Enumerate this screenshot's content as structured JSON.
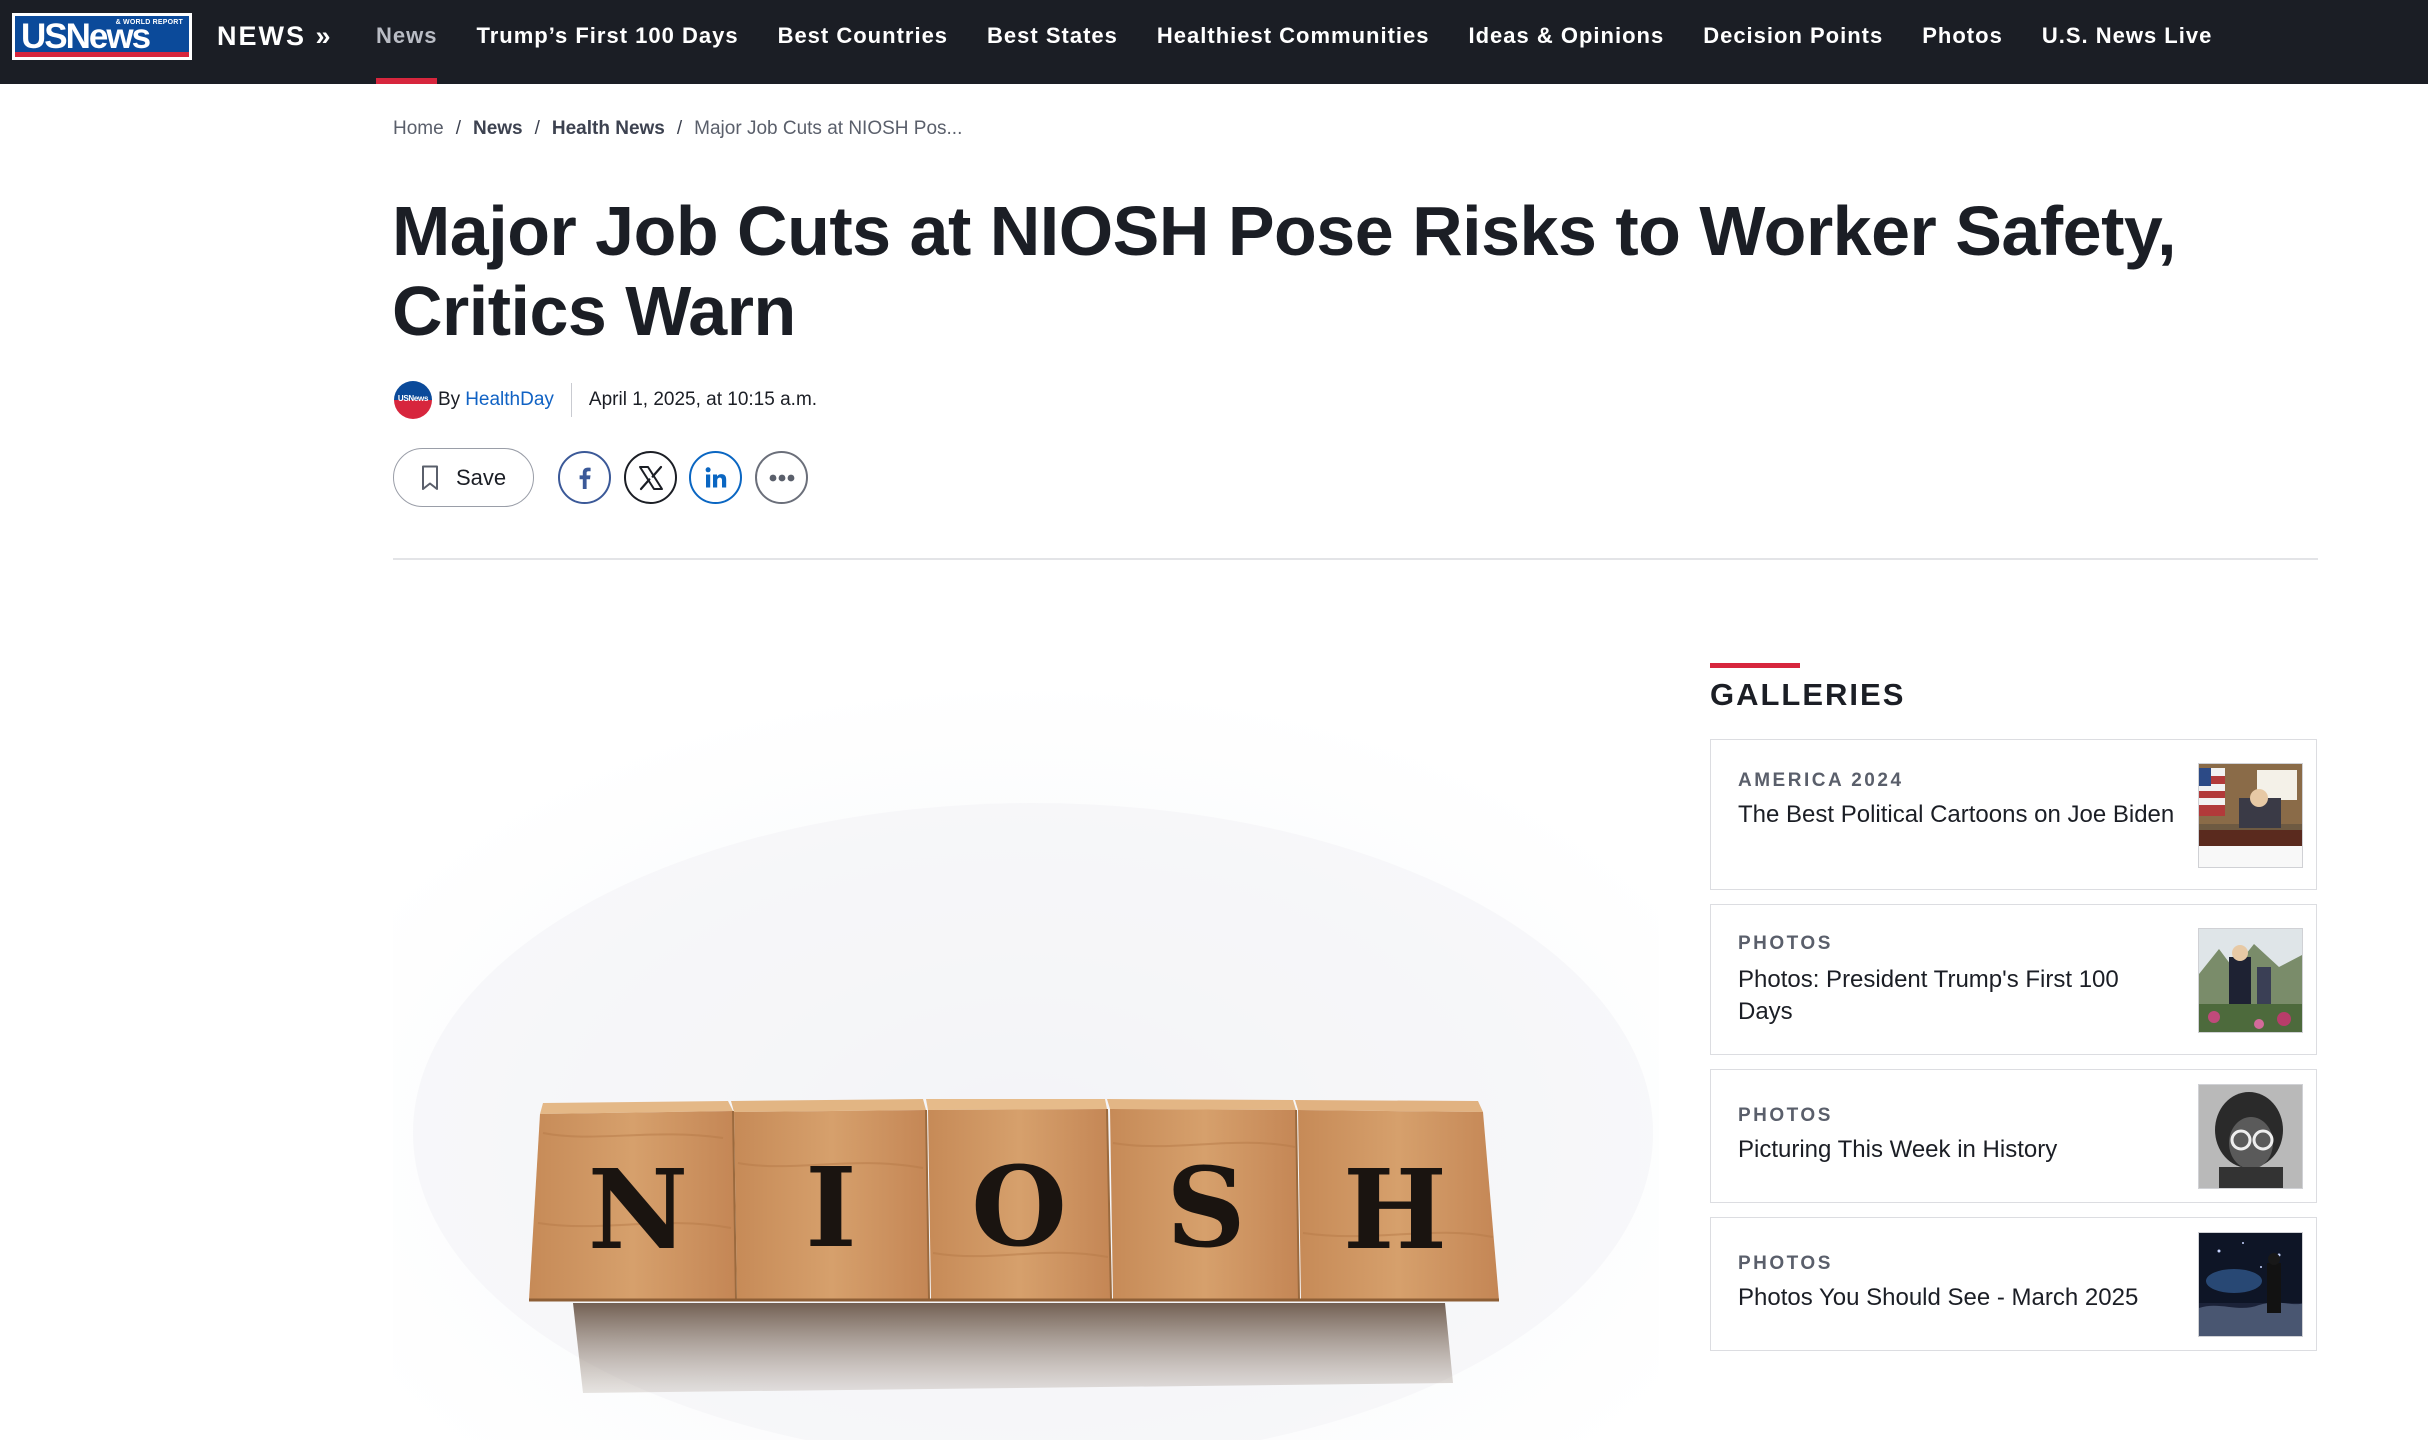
{
  "nav": {
    "logo_main": "USNews",
    "logo_small": "& WORLD REPORT",
    "section_label": "NEWS »",
    "items": [
      {
        "label": "News",
        "active": true
      },
      {
        "label": "Trump’s First 100 Days",
        "active": false
      },
      {
        "label": "Best Countries",
        "active": false
      },
      {
        "label": "Best States",
        "active": false
      },
      {
        "label": "Healthiest Communities",
        "active": false
      },
      {
        "label": "Ideas & Opinions",
        "active": false
      },
      {
        "label": "Decision Points",
        "active": false
      },
      {
        "label": "Photos",
        "active": false
      },
      {
        "label": "U.S. News Live",
        "active": false
      }
    ]
  },
  "breadcrumb": {
    "items": [
      "Home",
      "News",
      "Health News",
      "Major Job Cuts at NIOSH Pos..."
    ],
    "separator": "/"
  },
  "article": {
    "headline": "Major Job Cuts at NIOSH Pose Risks to Worker Safety, Critics Warn",
    "avatar_text": "USNews",
    "byline_prefix": "By",
    "author": "HealthDay",
    "date": "April 1, 2025, at 10:15 a.m.",
    "save_label": "Save",
    "share": {
      "facebook": "facebook-icon",
      "x": "x-icon",
      "linkedin": "linkedin-icon",
      "more": "more-icon"
    },
    "hero_letters": [
      "N",
      "I",
      "O",
      "S",
      "H"
    ]
  },
  "galleries": {
    "title": "GALLERIES",
    "items": [
      {
        "kicker": "AMERICA 2024",
        "title": "The Best Political Cartoons on Joe Biden"
      },
      {
        "kicker": "PHOTOS",
        "title": "Photos: President Trump's First 100 Days"
      },
      {
        "kicker": "PHOTOS",
        "title": "Picturing This Week in History"
      },
      {
        "kicker": "PHOTOS",
        "title": "Photos You Should See - March 2025"
      }
    ]
  },
  "colors": {
    "nav_bg": "#1b1e25",
    "accent_red": "#d7263d",
    "link_blue": "#1062c4",
    "brand_blue": "#0b4a9a"
  }
}
